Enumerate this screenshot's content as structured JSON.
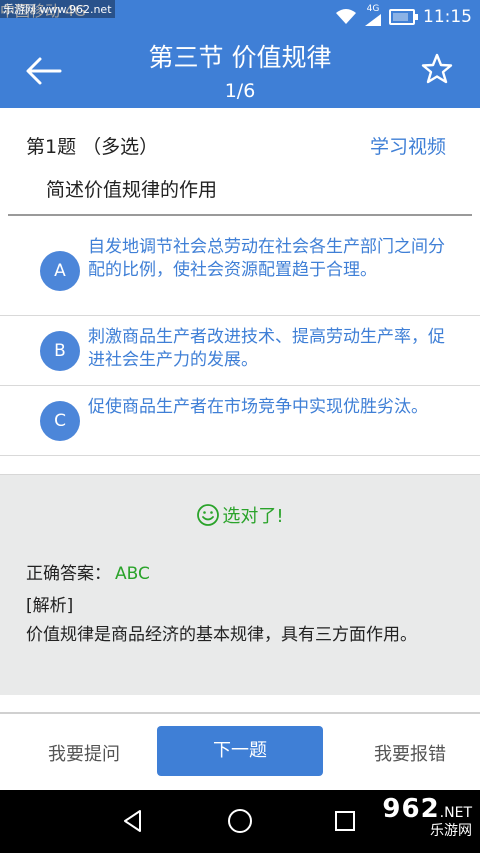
{
  "status_bar": {
    "carrier": "中国移动 4G",
    "watermark": "乐游网 www.962.net",
    "network": "4G",
    "time": "11:15"
  },
  "header": {
    "title": "第三节 价值规律",
    "counter": "1/6"
  },
  "question": {
    "number_label": "第1题 （多选）",
    "video_link": "学习视频",
    "text": "简述价值规律的作用"
  },
  "options": [
    {
      "letter": "A",
      "text": "自发地调节社会总劳动在社会各生产部门之间分配的比例，使社会资源配置趋于合理。"
    },
    {
      "letter": "B",
      "text": "刺激商品生产者改进技术、提高劳动生产率，促进社会生产力的发展。"
    },
    {
      "letter": "C",
      "text": "促使商品生产者在市场竞争中实现优胜劣汰。"
    }
  ],
  "answer": {
    "result_text": "选对了!",
    "correct_label": "正确答案：",
    "correct_value": "ABC",
    "analysis_title": "[解析]",
    "analysis_text": "价值规律是商品经济的基本规律，具有三方面作用。"
  },
  "bottom_bar": {
    "ask": "我要提问",
    "next": "下一题",
    "report": "我要报错"
  },
  "brand_logo": {
    "number": "962",
    "suffix": ".NET",
    "name": "乐游网"
  },
  "colors": {
    "primary": "#3f7fd6",
    "correct": "#2aa32a",
    "panel": "#e9eaea"
  }
}
